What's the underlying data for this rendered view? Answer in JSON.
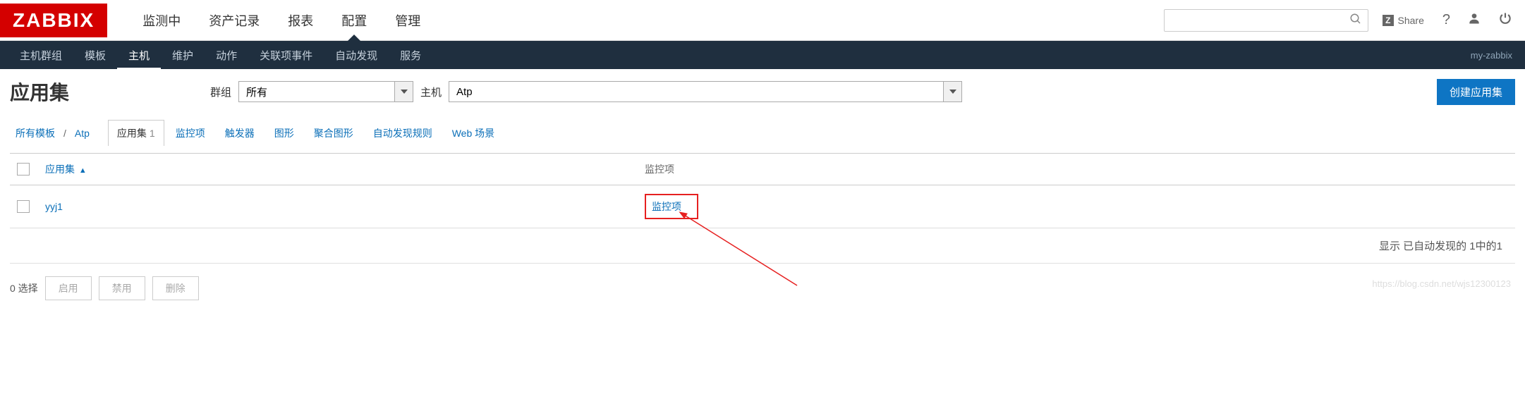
{
  "logo": "ZABBIX",
  "main_nav": [
    "监测中",
    "资产记录",
    "报表",
    "配置",
    "管理"
  ],
  "main_nav_active": 3,
  "share_label": "Share",
  "sub_nav": [
    "主机群组",
    "模板",
    "主机",
    "维护",
    "动作",
    "关联项事件",
    "自动发现",
    "服务"
  ],
  "sub_nav_active": 2,
  "server_name": "my-zabbix",
  "page_title": "应用集",
  "filter": {
    "group_label": "群组",
    "group_value": "所有",
    "host_label": "主机",
    "host_value": "Atp"
  },
  "create_btn": "创建应用集",
  "breadcrumb": {
    "all_templates": "所有模板",
    "host": "Atp"
  },
  "tabs": [
    {
      "label": "应用集",
      "count": "1",
      "active": true
    },
    {
      "label": "监控项"
    },
    {
      "label": "触发器"
    },
    {
      "label": "图形"
    },
    {
      "label": "聚合图形"
    },
    {
      "label": "自动发现规则"
    },
    {
      "label": "Web 场景"
    }
  ],
  "table": {
    "headers": {
      "name": "应用集",
      "items": "监控项"
    },
    "rows": [
      {
        "name": "yyj1",
        "items_link": "监控项"
      }
    ]
  },
  "footer": "显示 已自动发现的 1中的1",
  "bulk": {
    "selected_label": "0 选择",
    "enable": "启用",
    "disable": "禁用",
    "delete": "删除"
  }
}
